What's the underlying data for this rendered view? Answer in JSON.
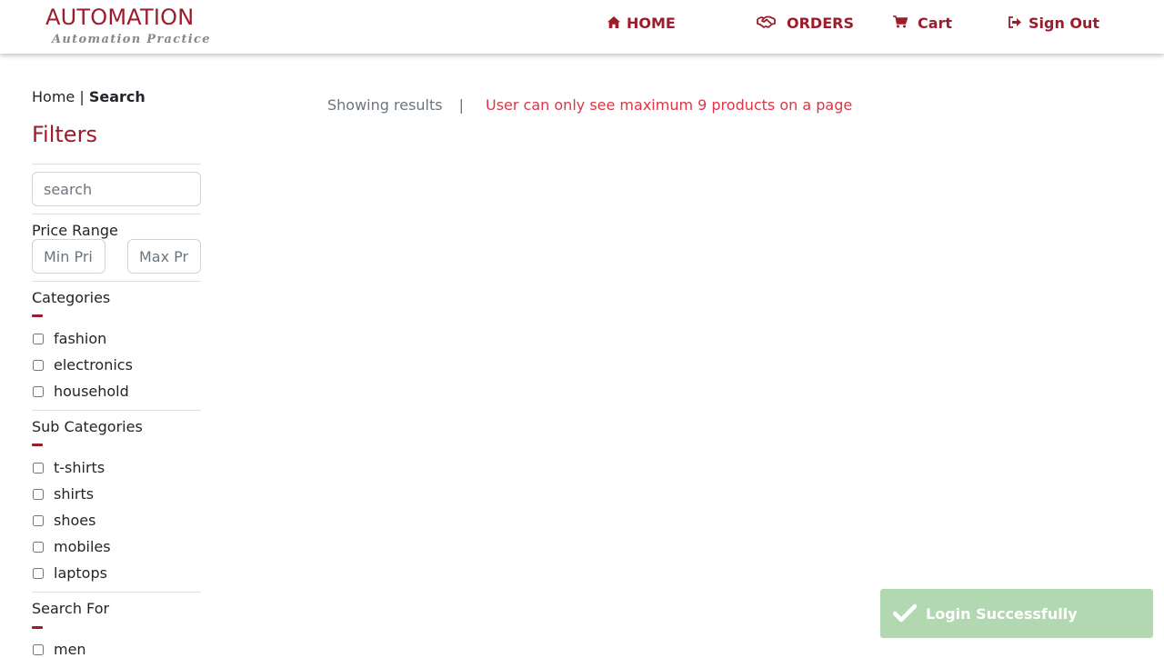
{
  "header": {
    "brand_title": "AUTOMATION",
    "brand_subtitle": "Automation Practice",
    "nav": {
      "home": "HOME",
      "orders": "ORDERS",
      "cart": "Cart",
      "signout": "Sign Out"
    },
    "accent_color": "#9b1c2b"
  },
  "breadcrumb": {
    "home": "Home",
    "separator": "|",
    "current": "Search"
  },
  "filters": {
    "title": "Filters",
    "search_placeholder": "search",
    "price_range_label": "Price Range",
    "min_price_placeholder": "Min Price",
    "max_price_placeholder": "Max Price",
    "categories_label": "Categories",
    "categories": [
      "fashion",
      "electronics",
      "household"
    ],
    "sub_categories_label": "Sub Categories",
    "sub_categories": [
      "t-shirts",
      "shirts",
      "shoes",
      "mobiles",
      "laptops"
    ],
    "search_for_label": "Search For",
    "search_for": [
      "men"
    ]
  },
  "results": {
    "showing": "Showing results",
    "separator": "|",
    "note": "User can only see maximum 9 products on a page"
  },
  "toast": {
    "message": "Login Successfully",
    "color": "#b2d8b2"
  }
}
